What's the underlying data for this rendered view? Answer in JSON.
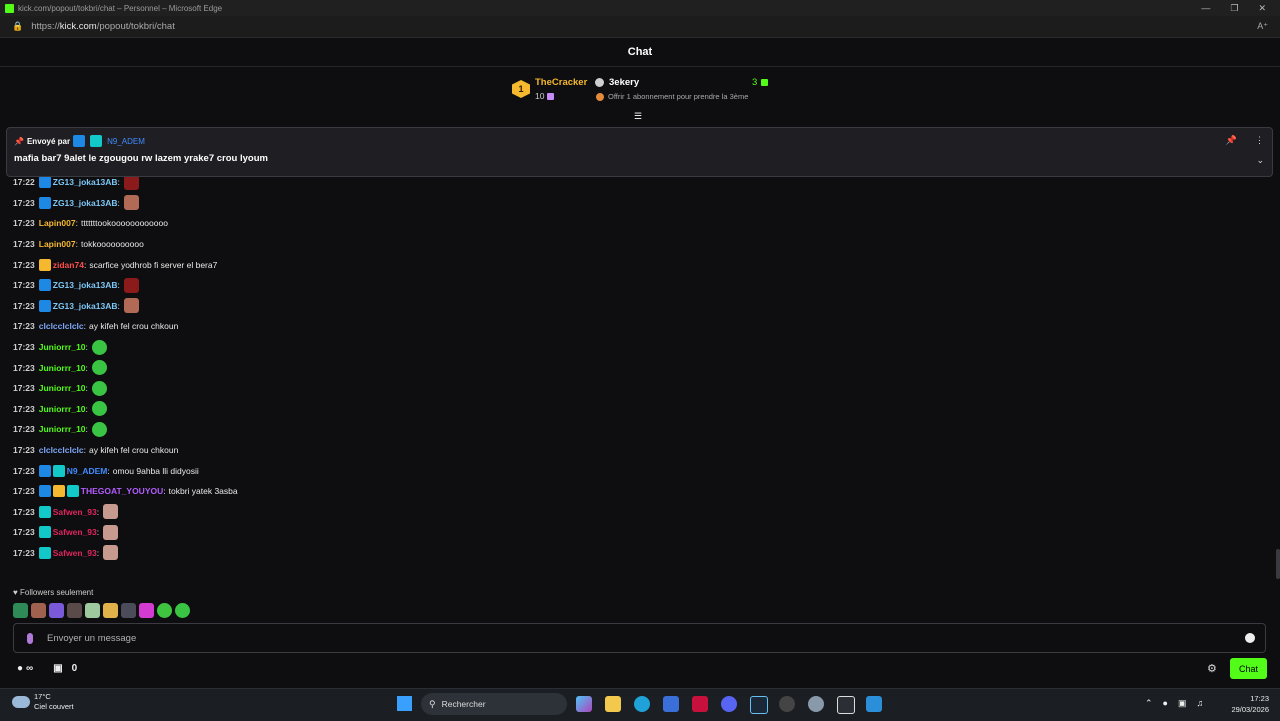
{
  "browser": {
    "title": "kick.com/popout/tokbri/chat – Personnel – Microsoft Edge",
    "url_prefix": "https://",
    "url_domain": "kick.com",
    "url_path": "/popout/tokbri/chat"
  },
  "header": {
    "title": "Chat"
  },
  "leaderboard": {
    "rank": "1",
    "top_user": "TheCracker",
    "top_count": "10",
    "second_user": "3ekery",
    "second_score": "3",
    "offer_text": "Offrir 1 abonnement pour prendre la 3ème"
  },
  "pinned": {
    "sent_by_label": "Envoyé par",
    "sender": "N9_ADEM",
    "message": "mafia bar7 9alet le zgougou rw lazem yrake7 crou lyoum"
  },
  "messages": [
    {
      "time": "17:22",
      "user": "ZG13_joka13AB",
      "color": "#7ec8f7",
      "badges": [
        "blue"
      ],
      "text": "",
      "emote": "e-red"
    },
    {
      "time": "17:23",
      "user": "ZG13_joka13AB",
      "color": "#7ec8f7",
      "badges": [
        "blue"
      ],
      "text": "",
      "emote": "e-face"
    },
    {
      "time": "17:23",
      "user": "Lapin007",
      "color": "#f5b82e",
      "badges": [],
      "text": "tttttttookoooooooooooo",
      "emote": ""
    },
    {
      "time": "17:23",
      "user": "Lapin007",
      "color": "#f5b82e",
      "badges": [],
      "text": "tokkoooooooooo",
      "emote": ""
    },
    {
      "time": "17:23",
      "user": "zidan74",
      "color": "#ff4d4d",
      "badges": [
        "gold"
      ],
      "text": "scarfice yodhrob fi server el bera7",
      "emote": ""
    },
    {
      "time": "17:23",
      "user": "ZG13_joka13AB",
      "color": "#7ec8f7",
      "badges": [
        "blue"
      ],
      "text": "",
      "emote": "e-red"
    },
    {
      "time": "17:23",
      "user": "ZG13_joka13AB",
      "color": "#7ec8f7",
      "badges": [
        "blue"
      ],
      "text": "",
      "emote": "e-face"
    },
    {
      "time": "17:23",
      "user": "clclcclclclc",
      "color": "#7ea7f7",
      "badges": [],
      "text": "ay kifeh fel crou chkoun",
      "emote": ""
    },
    {
      "time": "17:23",
      "user": "Juniorrr_10",
      "color": "#53fc18",
      "badges": [],
      "text": "",
      "emote": "e-frog"
    },
    {
      "time": "17:23",
      "user": "Juniorrr_10",
      "color": "#53fc18",
      "badges": [],
      "text": "",
      "emote": "e-frog"
    },
    {
      "time": "17:23",
      "user": "Juniorrr_10",
      "color": "#53fc18",
      "badges": [],
      "text": "",
      "emote": "e-frog"
    },
    {
      "time": "17:23",
      "user": "Juniorrr_10",
      "color": "#53fc18",
      "badges": [],
      "text": "",
      "emote": "e-frog"
    },
    {
      "time": "17:23",
      "user": "Juniorrr_10",
      "color": "#53fc18",
      "badges": [],
      "text": "",
      "emote": "e-frog"
    },
    {
      "time": "17:23",
      "user": "clclcclclclc",
      "color": "#7ea7f7",
      "badges": [],
      "text": "ay kifeh fel crou chkoun",
      "emote": ""
    },
    {
      "time": "17:23",
      "user": "N9_ADEM",
      "color": "#3f8cff",
      "badges": [
        "blue",
        "cyan"
      ],
      "text": "omou 9ahba lli didyosii",
      "emote": ""
    },
    {
      "time": "17:23",
      "user": "THEGOAT_YOUYOU",
      "color": "#b45cff",
      "badges": [
        "blue",
        "gold",
        "cyan"
      ],
      "text": "tokbri yatek 3asba",
      "emote": ""
    },
    {
      "time": "17:23",
      "user": "Safwen_93",
      "color": "#e0245e",
      "badges": [
        "cyan"
      ],
      "text": "",
      "emote": "e-cat"
    },
    {
      "time": "17:23",
      "user": "Safwen_93",
      "color": "#e0245e",
      "badges": [
        "cyan"
      ],
      "text": "",
      "emote": "e-cat"
    },
    {
      "time": "17:23",
      "user": "Safwen_93",
      "color": "#e0245e",
      "badges": [
        "cyan"
      ],
      "text": "",
      "emote": "e-cat"
    }
  ],
  "footer": {
    "followers_label": "Followers seulement",
    "input_placeholder": "Envoyer un message",
    "infinity_label": "∞",
    "gift_count": "0",
    "chat_button": "Chat"
  },
  "taskbar": {
    "temperature": "17°C",
    "weather": "Ciel couvert",
    "search_label": "Rechercher",
    "time": "17:23",
    "date": "29/03/2026"
  },
  "colors": {
    "accent": "#53fc18",
    "background": "#0e0e10",
    "gold": "#f5b82e"
  }
}
